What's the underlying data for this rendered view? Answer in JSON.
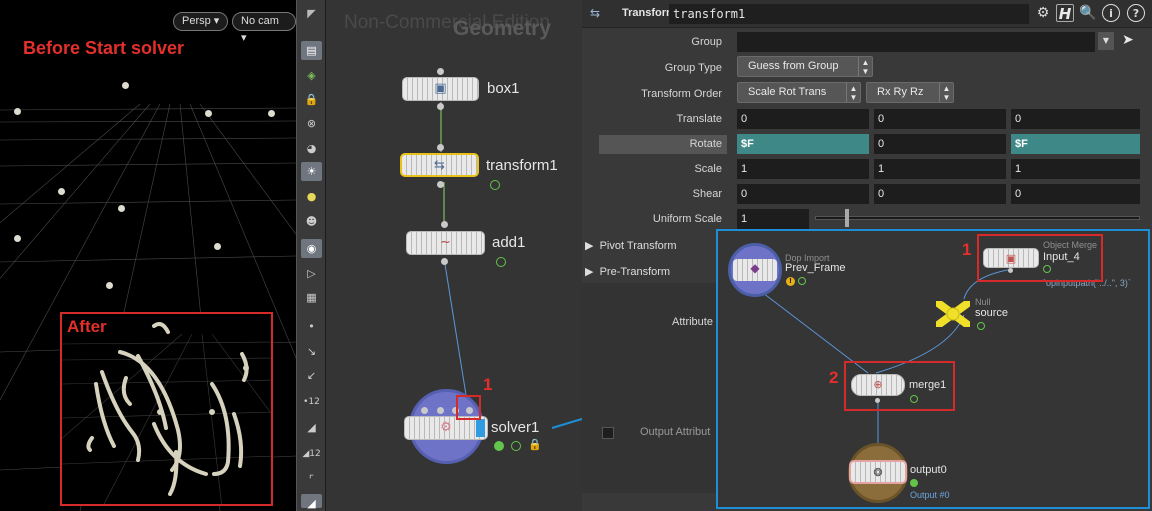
{
  "viewport": {
    "persp_label": "Persp ▾",
    "cam_label": "No cam ▾",
    "before_title": "Before Start solver",
    "after_title": "After"
  },
  "network": {
    "watermark": "Non-Commercial Edition",
    "context_title": "Geometry",
    "nodes": {
      "box1": "box1",
      "transform1": "transform1",
      "add1": "add1",
      "solver1": "solver1"
    },
    "annotation_number": "1"
  },
  "params": {
    "type_label": "Transform",
    "node_name": "transform1",
    "rows": {
      "group": "Group",
      "group_type": "Group Type",
      "group_type_value": "Guess from Group",
      "transform_order": "Transform Order",
      "transform_order_value": "Scale Rot Trans",
      "rotate_order_value": "Rx Ry Rz",
      "translate": "Translate",
      "rotate": "Rotate",
      "scale": "Scale",
      "shear": "Shear",
      "uniform_scale": "Uniform Scale"
    },
    "values": {
      "translate": [
        "0",
        "0",
        "0"
      ],
      "rotate": [
        "$F",
        "0",
        "$F"
      ],
      "scale": [
        "1",
        "1",
        "1"
      ],
      "shear": [
        "0",
        "0",
        "0"
      ],
      "uniform_scale": "1"
    },
    "folders": {
      "pivot": "Pivot Transform",
      "pre": "Pre-Transform"
    },
    "partial_labels": {
      "attribute": "Attribute",
      "output_attribute": "Output Attribut"
    }
  },
  "solver_net": {
    "prev_frame_type": "Dop Import",
    "prev_frame_name": "Prev_Frame",
    "object_merge_type": "Object Merge",
    "object_merge_name": "Input_4",
    "object_merge_expr": "`opinputpath(\"../..\", 3)`",
    "null_type": "Null",
    "null_name": "source",
    "merge_name": "merge1",
    "output_name": "output0",
    "output_sub": "Output #0",
    "num1": "1",
    "num2": "2"
  },
  "colors": {
    "annotation_red": "#e3302c",
    "highlight_blue": "#1d8fd6",
    "teal_field": "#3e8887",
    "selected_node": "#e8c21a"
  }
}
